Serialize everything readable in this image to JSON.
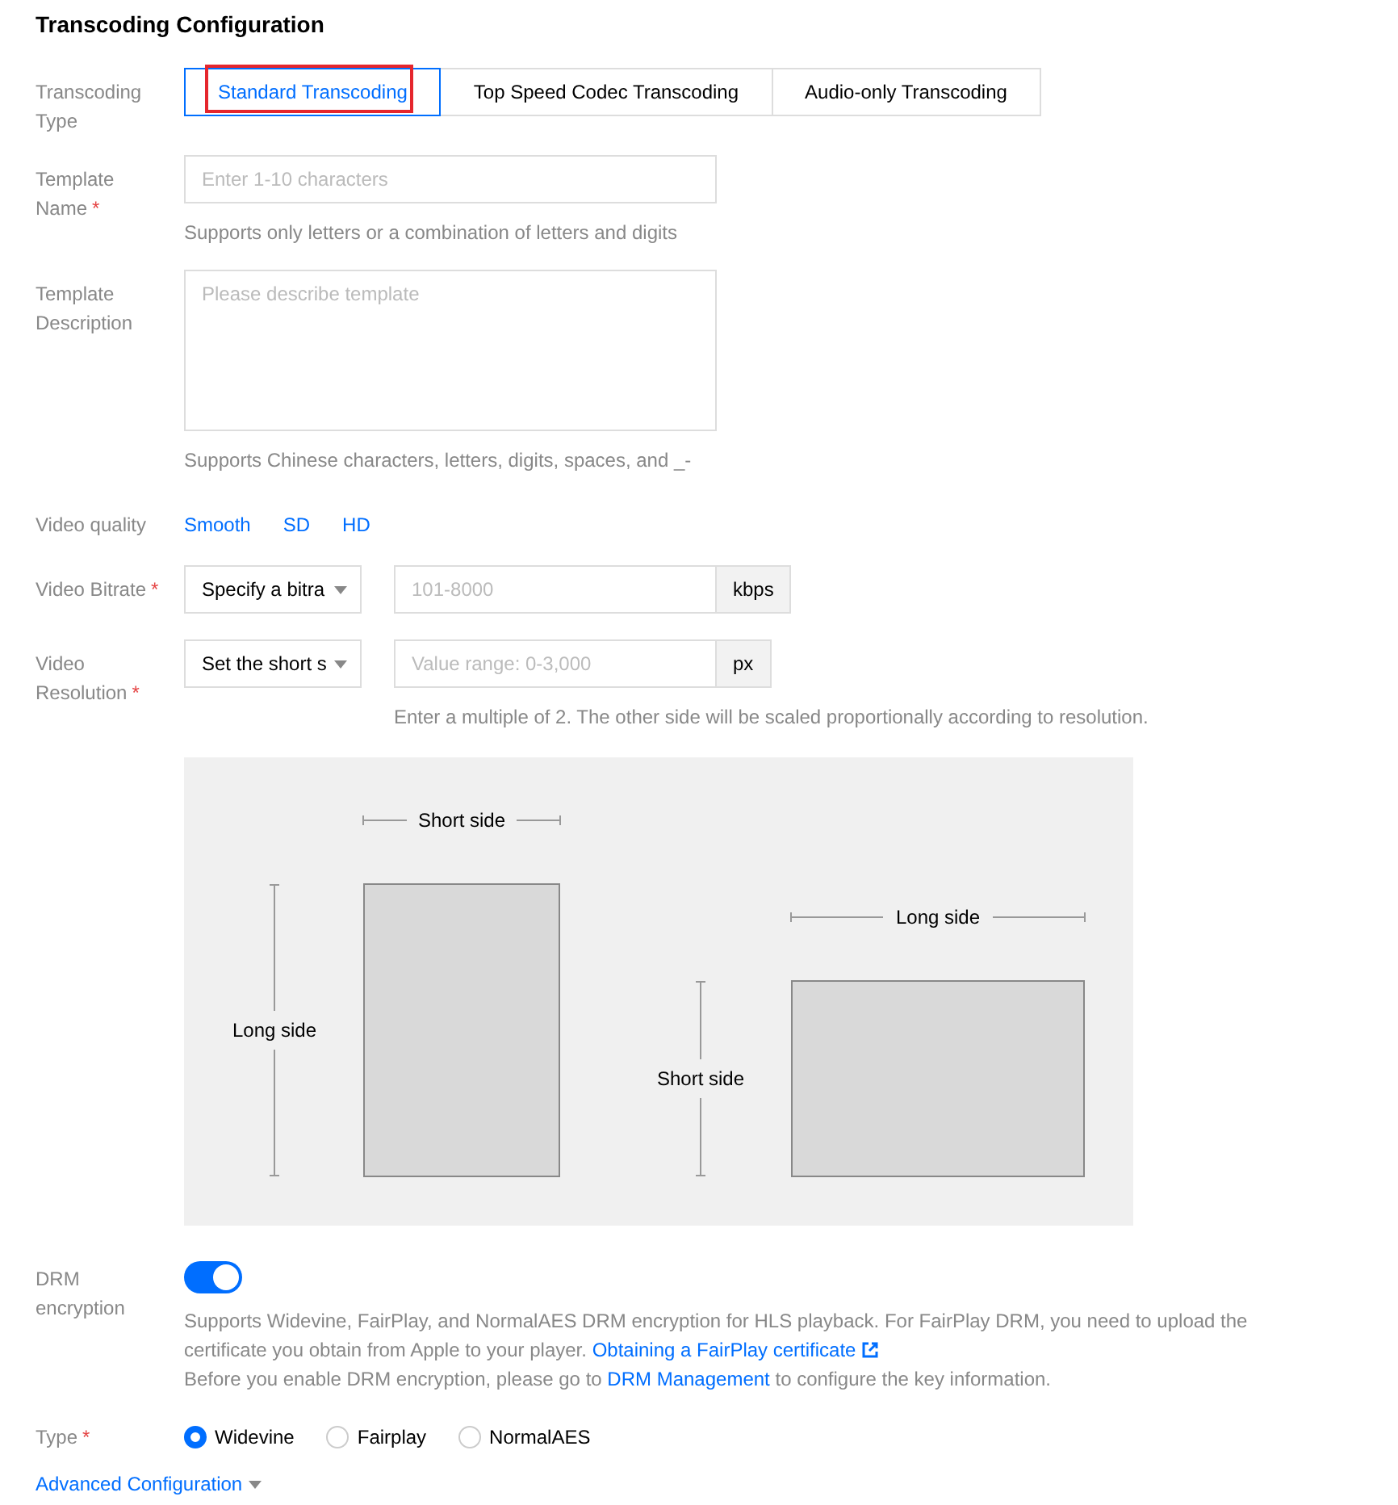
{
  "title": "Transcoding Configuration",
  "transcoding_type": {
    "label": "Transcoding Type",
    "tabs": [
      {
        "label": "Standard Transcoding",
        "selected": true,
        "annotated": true
      },
      {
        "label": "Top Speed Codec Transcoding",
        "selected": false,
        "annotated": false
      },
      {
        "label": "Audio-only Transcoding",
        "selected": false,
        "annotated": false
      }
    ]
  },
  "template_name": {
    "label": "Template Name",
    "required_mark": "*",
    "placeholder": "Enter 1-10 characters",
    "hint": "Supports only letters or a combination of letters and digits"
  },
  "template_description": {
    "label": "Template Description",
    "placeholder": "Please describe template",
    "hint": "Supports Chinese characters, letters, digits, spaces, and _-"
  },
  "video_quality": {
    "label": "Video quality",
    "options": [
      "Smooth",
      "SD",
      "HD"
    ]
  },
  "video_bitrate": {
    "label": "Video Bitrate",
    "required_mark": "*",
    "select": "Specify a bitra",
    "placeholder": "101-8000",
    "unit": "kbps"
  },
  "video_resolution": {
    "label": "Video Resolution",
    "required_mark": "*",
    "select": "Set the short s",
    "placeholder": "Value range: 0-3,000",
    "unit": "px",
    "hint": "Enter a multiple of 2. The other side will be scaled proportionally according to resolution."
  },
  "diagram": {
    "portrait": {
      "top": "Short side",
      "left": "Long side"
    },
    "landscape": {
      "top": "Long side",
      "left": "Short side"
    }
  },
  "drm": {
    "label": "DRM encryption",
    "on": true,
    "text": "Supports Widevine, FairPlay, and NormalAES DRM encryption for HLS playback. For FairPlay DRM, you need to upload the certificate you obtain from Apple to your player.",
    "link": "Obtaining a FairPlay certificate",
    "text2_before": "Before you enable DRM encryption, please go to",
    "link2": "DRM Management",
    "text2_after": "to configure the key information."
  },
  "type": {
    "label": "Type",
    "required_mark": "*",
    "options": [
      {
        "label": "Widevine",
        "selected": true
      },
      {
        "label": "Fairplay",
        "selected": false
      },
      {
        "label": "NormalAES",
        "selected": false
      }
    ]
  },
  "advanced": {
    "label": "Advanced Configuration",
    "expanded": false
  }
}
